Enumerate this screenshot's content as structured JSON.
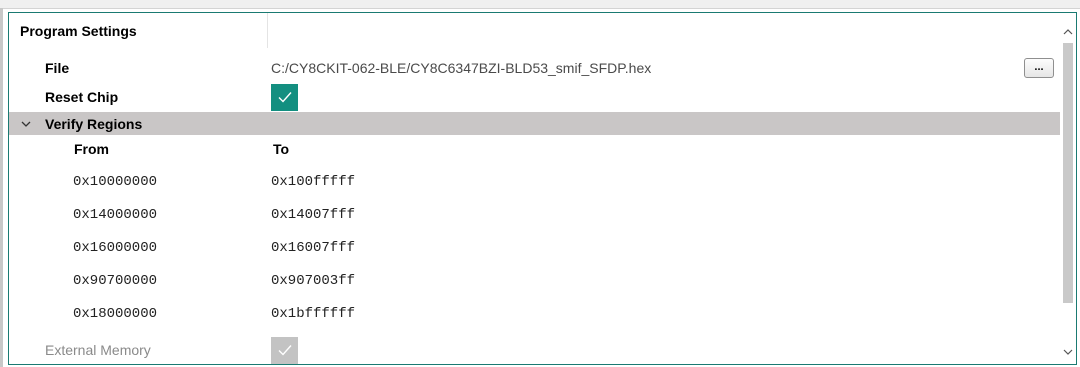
{
  "program_settings": {
    "header_label": "Program Settings",
    "file": {
      "label": "File",
      "value": "C:/CY8CKIT-062-BLE/CY8C6347BZI-BLD53_smif_SFDP.hex",
      "browse_label": "..."
    },
    "reset_chip": {
      "label": "Reset Chip",
      "checked": true
    },
    "verify_regions": {
      "label": "Verify Regions",
      "expanded": true,
      "columns": {
        "from": "From",
        "to": "To"
      },
      "rows": [
        {
          "from": "0x10000000",
          "to": "0x100fffff"
        },
        {
          "from": "0x14000000",
          "to": "0x14007fff"
        },
        {
          "from": "0x16000000",
          "to": "0x16007fff"
        },
        {
          "from": "0x90700000",
          "to": "0x907003ff"
        },
        {
          "from": "0x18000000",
          "to": "0x1bffffff"
        }
      ]
    },
    "external_memory": {
      "label": "External Memory",
      "checked": true,
      "enabled": false
    }
  },
  "colors": {
    "panel_border": "#1a7a72",
    "checkbox_checked": "#138f80",
    "checkbox_disabled": "#c3c3c3",
    "group_row_bg": "#c9c6c6"
  },
  "icons": {
    "collapse": "chevron-down-icon",
    "check": "checkmark-icon",
    "scroll_up": "arrow-up-icon",
    "scroll_down": "arrow-down-icon"
  }
}
